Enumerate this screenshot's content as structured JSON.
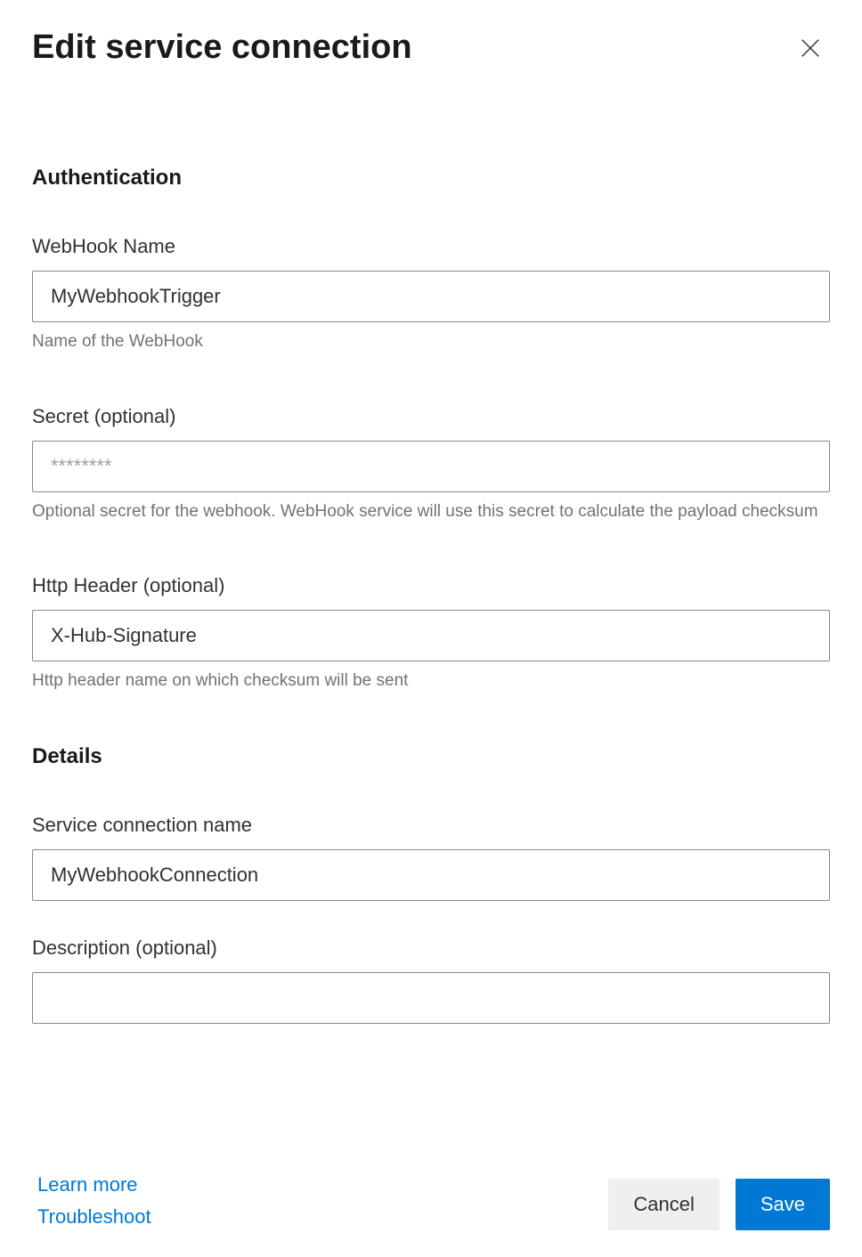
{
  "header": {
    "title": "Edit service connection"
  },
  "sections": {
    "authentication": {
      "heading": "Authentication",
      "webhookName": {
        "label": "WebHook Name",
        "value": "MyWebhookTrigger",
        "help": "Name of the WebHook"
      },
      "secret": {
        "label": "Secret (optional)",
        "placeholder": "********",
        "help": "Optional secret for the webhook. WebHook service will use this secret to calculate the payload checksum"
      },
      "httpHeader": {
        "label": "Http Header (optional)",
        "value": "X-Hub-Signature",
        "help": "Http header name on which checksum will be sent"
      }
    },
    "details": {
      "heading": "Details",
      "serviceConnectionName": {
        "label": "Service connection name",
        "value": "MyWebhookConnection"
      },
      "description": {
        "label": "Description (optional)",
        "value": ""
      }
    }
  },
  "footer": {
    "learnMore": "Learn more",
    "troubleshoot": "Troubleshoot",
    "cancel": "Cancel",
    "save": "Save"
  }
}
